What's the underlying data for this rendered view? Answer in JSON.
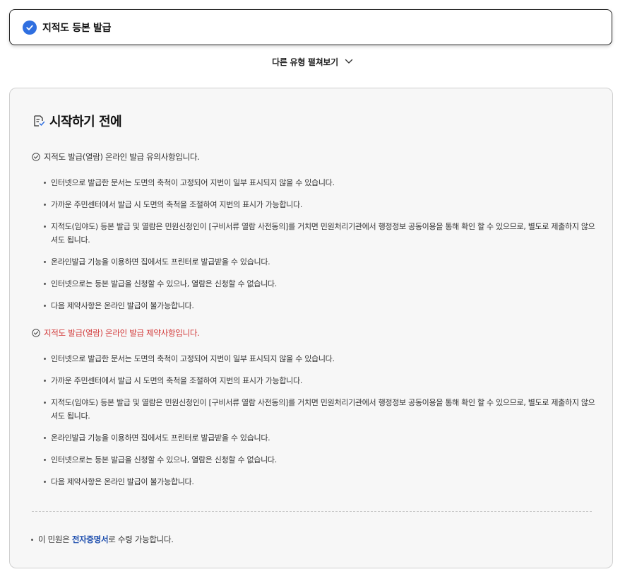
{
  "selected": {
    "label": "지적도 등본 발급"
  },
  "expand": {
    "label": "다른 유형 펼쳐보기"
  },
  "panel": {
    "title": "시작하기 전에",
    "sections": [
      {
        "heading": "지적도 발급(열람) 온라인 발급 유의사항입니다.",
        "items": [
          "인터넷으로 발급한 문서는 도면의 축척이 고정되어 지번이 일부 표시되지 않을 수 있습니다.",
          "가까운 주민센터에서 발급 시 도면의 축척을 조절하여 지번의 표시가 가능합니다.",
          "지적도(임야도) 등본 발급 및 열람은 민원신청인이 [구비서류 열람 사전동의]를 거치면 민원처리기관에서 행정정보 공동이용을 통해 확인 할 수 있으므로, 별도로 제출하지 않으셔도 됩니다.",
          "온라인발급 기능을 이용하면 집에서도 프린터로 발급받을 수 있습니다.",
          "인터넷으로는 등본 발급을 신청할 수 있으나, 열람은 신청할 수 없습니다.",
          "다음 제약사항은 온라인 발급이 불가능합니다."
        ]
      },
      {
        "heading": "지적도 발급(열람) 온라인 발급 제약사항입니다.",
        "items": [
          "인터넷으로 발급한 문서는 도면의 축척이 고정되어 지번이 일부 표시되지 않을 수 있습니다.",
          "가까운 주민센터에서 발급 시 도면의 축척을 조절하여 지번의 표시가 가능합니다.",
          "지적도(임야도) 등본 발급 및 열람은 민원신청인이 [구비서류 열람 사전동의]를 거치면 민원처리기관에서 행정정보 공동이용을 통해 확인 할 수 있으므로, 별도로 제출하지 않으셔도 됩니다.",
          "온라인발급 기능을 이용하면 집에서도 프린터로 발급받을 수 있습니다.",
          "인터넷으로는 등본 발급을 신청할 수 있으나, 열람은 신청할 수 없습니다.",
          "다음 제약사항은 온라인 발급이 불가능합니다."
        ]
      }
    ],
    "note": {
      "prefix": "이 민원은 ",
      "highlight": "전자증명서",
      "suffix": "로 수령 가능합니다."
    }
  },
  "colors": {
    "accent": "#2f6fe0",
    "warning": "#d23a3a",
    "highlight": "#1f4fae"
  },
  "icons": {
    "selected": "check-circle-icon",
    "expand": "chevron-down-icon",
    "title": "checklist-icon",
    "section": "check-outline-icon"
  }
}
